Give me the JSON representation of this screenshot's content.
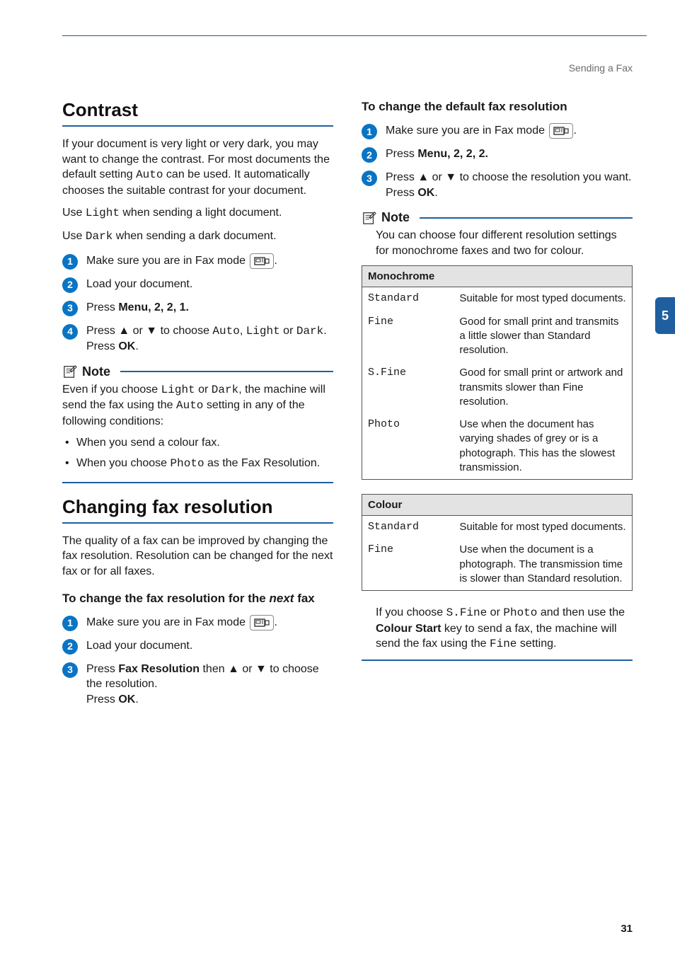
{
  "crumb": "Sending a Fax",
  "side_tab": "5",
  "page_number": "31",
  "left": {
    "h_contrast": "Contrast",
    "contrast_intro": "If your document is very light or very dark, you may want to change the contrast. For most documents the default setting ",
    "contrast_intro_auto": "Auto",
    "contrast_intro_tail": " can be used. It automatically chooses the suitable contrast for your document.",
    "use_light_pre": "Use ",
    "use_light_code": "Light",
    "use_light_post": " when sending a light document.",
    "use_dark_pre": "Use ",
    "use_dark_code": "Dark",
    "use_dark_post": " when sending a dark document.",
    "step1_fax": "Make sure you are in Fax mode ",
    "step_tail_dot": ".",
    "step2_load": "Load your document.",
    "step3_pre": "Press ",
    "step3_menu": "Menu",
    "step3_post": ", 2, 2, 1.",
    "step4_pre": "Press ▲ or ▼ to choose ",
    "step4_auto": "Auto",
    "step4_mid1": ", ",
    "step4_light": "Light",
    "step4_mid2": " or ",
    "step4_dark": "Dark",
    "step4_tail": ".",
    "step4_ok_pre": "Press ",
    "step4_ok": "OK",
    "step4_ok_post": ".",
    "note_title": "Note",
    "note_body_pre": "Even if you choose ",
    "note_body_light": "Light",
    "note_body_mid": " or ",
    "note_body_dark": "Dark",
    "note_body_mid2": ", the machine will send the fax using the ",
    "note_body_auto": "Auto",
    "note_body_tail": " setting in any of the following conditions:",
    "bullet1": "When you send a colour fax.",
    "bullet2_pre": "When you choose ",
    "bullet2_code": "Photo",
    "bullet2_post": " as the Fax Resolution.",
    "h_changing": "Changing fax resolution",
    "changing_intro": "The quality of a fax can be improved by changing the fax resolution. Resolution can be changed for the next fax or for all faxes.",
    "sub_next_pre": "To change the fax resolution for the ",
    "sub_next_em": "next",
    "sub_next_post": " fax",
    "next_step1": "Make sure you are in Fax mode ",
    "next_step2": "Load your document.",
    "next_step3_pre": "Press ",
    "next_step3_btn": "Fax Resolution",
    "next_step3_mid": " then ▲ or ▼ to choose the resolution.",
    "next_step3_ok_pre": "Press ",
    "next_step3_ok": "OK",
    "next_step3_ok_post": "."
  },
  "right": {
    "sub_default": "To change the default fax resolution",
    "d_step1": "Make sure you are in Fax mode ",
    "d_step2_pre": "Press ",
    "d_step2_menu": "Menu",
    "d_step2_post": ", 2, 2, 2.",
    "d_step3_line1": "Press ▲ or ▼ to choose the resolution you want.",
    "d_step3_ok_pre": "Press ",
    "d_step3_ok": "OK",
    "d_step3_ok_post": ".",
    "note_title": "Note",
    "note_body": "You can choose four different resolution settings for monochrome faxes and two for colour.",
    "mono_header": "Monochrome",
    "mono_rows": [
      {
        "k": "Standard",
        "v": "Suitable for most typed documents."
      },
      {
        "k": "Fine",
        "v": "Good for small print and transmits a little slower than Standard resolution."
      },
      {
        "k": "S.Fine",
        "v": "Good for small print or artwork and transmits slower than Fine resolution."
      },
      {
        "k": "Photo",
        "v": "Use when the document has varying shades of grey or is a photograph. This has the slowest transmission."
      }
    ],
    "colour_header": "Colour",
    "colour_rows": [
      {
        "k": "Standard",
        "v": "Suitable for most typed documents."
      },
      {
        "k": "Fine",
        "v": "Use when the document is a photograph. The transmission time is slower than Standard resolution."
      }
    ],
    "closing_pre": "If you choose ",
    "closing_sfine": "S.Fine",
    "closing_mid1": " or ",
    "closing_photo": "Photo",
    "closing_mid2": " and then use the ",
    "closing_cs": "Colour Start",
    "closing_mid3": " key to send a fax, the machine will send the fax using the ",
    "closing_fine": "Fine",
    "closing_tail": " setting."
  }
}
